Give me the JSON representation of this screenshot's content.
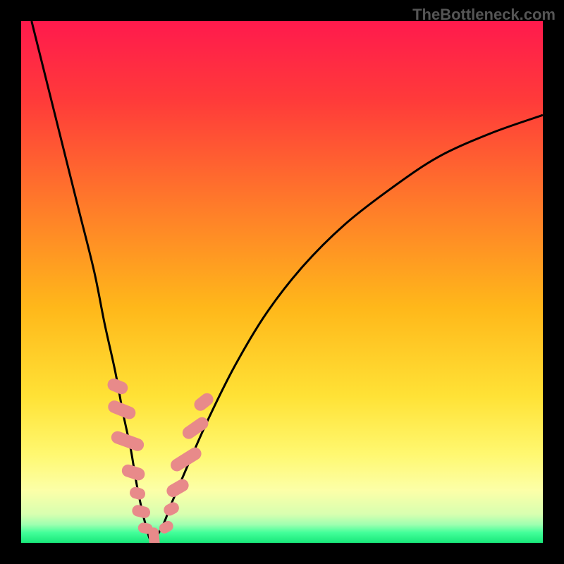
{
  "watermark": "TheBottleneck.com",
  "colors": {
    "bg_black": "#000000",
    "curve": "#000000",
    "marker": "#e88a8a",
    "gradient_stops": [
      {
        "offset": 0,
        "color": "#ff1a4d"
      },
      {
        "offset": 0.15,
        "color": "#ff3a3a"
      },
      {
        "offset": 0.35,
        "color": "#ff7a2a"
      },
      {
        "offset": 0.55,
        "color": "#ffb81a"
      },
      {
        "offset": 0.72,
        "color": "#ffe236"
      },
      {
        "offset": 0.83,
        "color": "#fff870"
      },
      {
        "offset": 0.9,
        "color": "#fcffa8"
      },
      {
        "offset": 0.945,
        "color": "#d8ffb0"
      },
      {
        "offset": 0.965,
        "color": "#9effb0"
      },
      {
        "offset": 0.98,
        "color": "#44ff9a"
      },
      {
        "offset": 1.0,
        "color": "#18e87a"
      }
    ]
  },
  "chart_data": {
    "type": "line",
    "title": "",
    "xlabel": "",
    "ylabel": "",
    "xlim": [
      0,
      100
    ],
    "ylim": [
      0,
      100
    ],
    "series": [
      {
        "name": "bottleneck-curve",
        "x": [
          2,
          5,
          8,
          11,
          14,
          16,
          18,
          19.5,
          21,
          22,
          23,
          24,
          25,
          27,
          29,
          32,
          36,
          41,
          47,
          54,
          62,
          71,
          80,
          90,
          100
        ],
        "y": [
          100,
          88,
          76,
          64,
          52,
          42,
          33,
          25,
          18,
          12,
          7,
          3,
          0.5,
          3,
          8,
          15,
          24,
          34,
          44,
          53,
          61,
          68,
          74,
          78.5,
          82
        ]
      }
    ],
    "markers": [
      {
        "x": 18.5,
        "y": 30,
        "w": 2.4,
        "h": 4.0,
        "angle": -68
      },
      {
        "x": 19.3,
        "y": 25.5,
        "w": 2.4,
        "h": 5.5,
        "angle": -68
      },
      {
        "x": 20.4,
        "y": 19.5,
        "w": 2.4,
        "h": 6.5,
        "angle": -70
      },
      {
        "x": 21.5,
        "y": 13.5,
        "w": 2.4,
        "h": 4.5,
        "angle": -72
      },
      {
        "x": 22.3,
        "y": 9.5,
        "w": 2.2,
        "h": 3.0,
        "angle": -74
      },
      {
        "x": 23.0,
        "y": 6.0,
        "w": 2.2,
        "h": 3.5,
        "angle": -76
      },
      {
        "x": 23.8,
        "y": 2.8,
        "w": 2.0,
        "h": 2.8,
        "angle": -80
      },
      {
        "x": 25.5,
        "y": 0.7,
        "w": 2.0,
        "h": 4.5,
        "angle": -5
      },
      {
        "x": 27.8,
        "y": 3.0,
        "w": 2.0,
        "h": 2.8,
        "angle": 60
      },
      {
        "x": 28.8,
        "y": 6.5,
        "w": 2.2,
        "h": 3.0,
        "angle": 62
      },
      {
        "x": 30.0,
        "y": 10.5,
        "w": 2.4,
        "h": 4.5,
        "angle": 60
      },
      {
        "x": 31.6,
        "y": 16.0,
        "w": 2.4,
        "h": 6.5,
        "angle": 58
      },
      {
        "x": 33.4,
        "y": 22.0,
        "w": 2.4,
        "h": 5.5,
        "angle": 55
      },
      {
        "x": 35.0,
        "y": 27.0,
        "w": 2.4,
        "h": 4.0,
        "angle": 52
      }
    ]
  }
}
